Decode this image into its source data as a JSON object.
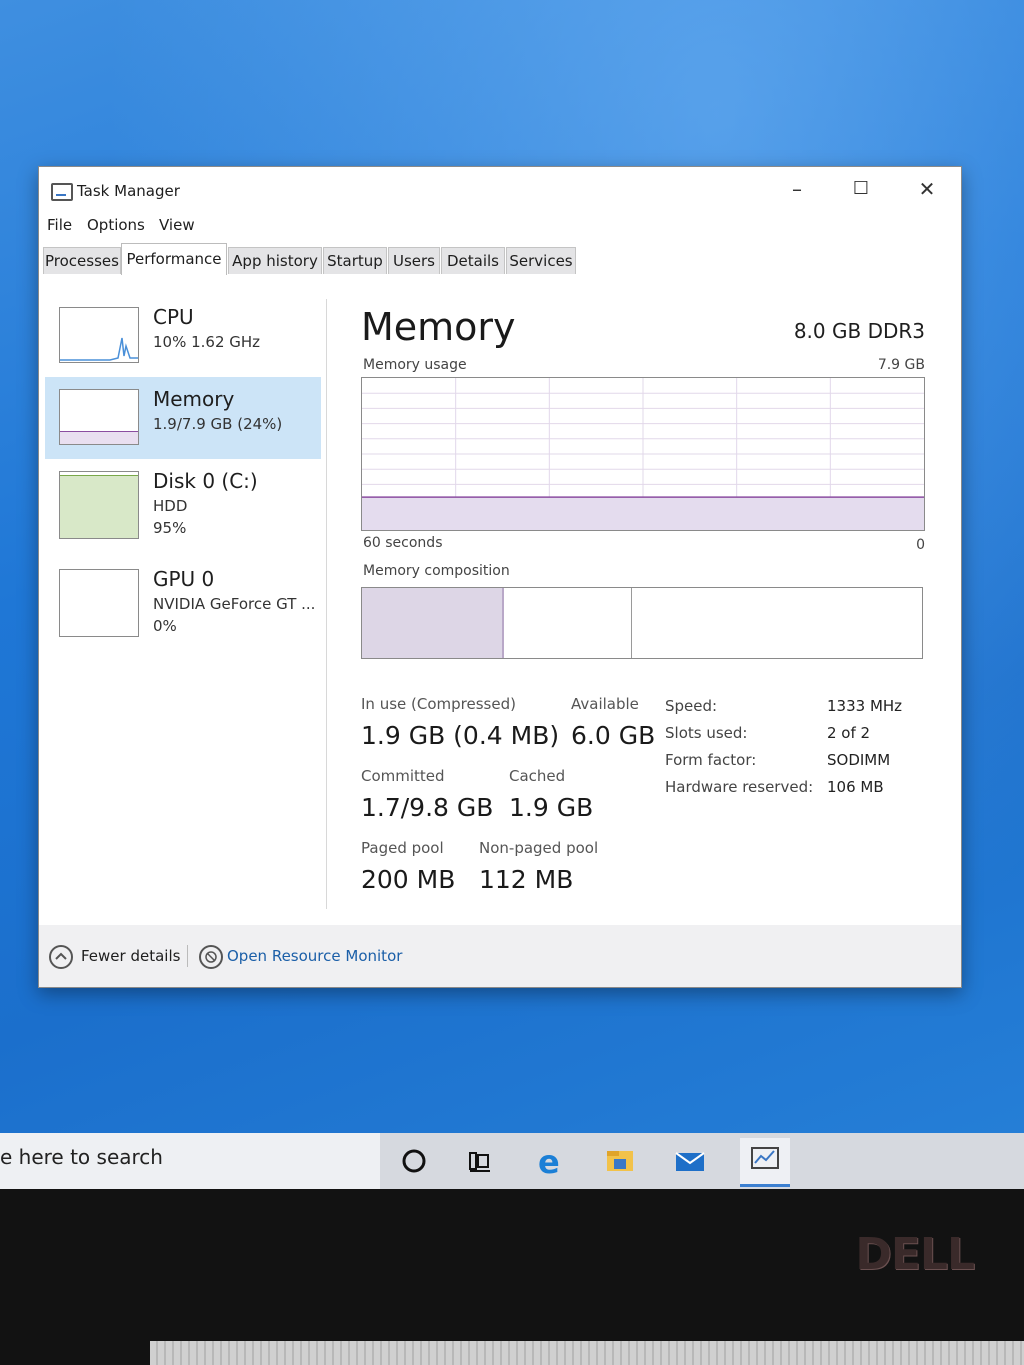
{
  "window": {
    "title": "Task Manager",
    "controls": {
      "minimize": "–",
      "maximize": "☐",
      "close": "✕"
    }
  },
  "menu": [
    "File",
    "Options",
    "View"
  ],
  "tabs": [
    "Processes",
    "Performance",
    "App history",
    "Startup",
    "Users",
    "Details",
    "Services"
  ],
  "active_tab": "Performance",
  "sidebar": [
    {
      "title": "CPU",
      "sub1": "10%  1.62 GHz",
      "sub2": "",
      "color": "#4a90d9"
    },
    {
      "title": "Memory",
      "sub1": "1.9/7.9 GB (24%)",
      "sub2": "",
      "color": "#8b4da0"
    },
    {
      "title": "Disk 0 (C:)",
      "sub1": "HDD",
      "sub2": "95%",
      "color": "#7aa84a"
    },
    {
      "title": "GPU 0",
      "sub1": "NVIDIA GeForce GT ...",
      "sub2": "0%",
      "color": "#a0a0a0"
    }
  ],
  "detail": {
    "heading": "Memory",
    "hardware": "8.0 GB DDR3",
    "usage_label": "Memory usage",
    "usage_max": "7.9 GB",
    "time_label": "60 seconds",
    "zero_label": "0",
    "composition_label": "Memory composition",
    "usage_fraction": 0.24,
    "composition": {
      "in_use_fraction": 0.24,
      "modified_fraction": 0.01,
      "standby_fraction": 0.23
    },
    "stats": {
      "in_use_label": "In use (Compressed)",
      "in_use_value": "1.9 GB (0.4 MB)",
      "available_label": "Available",
      "available_value": "6.0 GB",
      "committed_label": "Committed",
      "committed_value": "1.7/9.8 GB",
      "cached_label": "Cached",
      "cached_value": "1.9 GB",
      "paged_label": "Paged pool",
      "paged_value": "200 MB",
      "nonpaged_label": "Non-paged pool",
      "nonpaged_value": "112 MB"
    },
    "specs": [
      {
        "label": "Speed:",
        "value": "1333 MHz"
      },
      {
        "label": "Slots used:",
        "value": "2 of 2"
      },
      {
        "label": "Form factor:",
        "value": "SODIMM"
      },
      {
        "label": "Hardware reserved:",
        "value": "106 MB"
      }
    ]
  },
  "footer": {
    "fewer_details": "Fewer details",
    "resource_monitor": "Open Resource Monitor"
  },
  "taskbar": {
    "search_text": "e here to search",
    "icons": [
      "cortana-icon",
      "task-view-icon",
      "edge-icon",
      "file-explorer-icon",
      "mail-icon",
      "task-manager-icon"
    ]
  },
  "bezel": {
    "logo": "DELL"
  }
}
